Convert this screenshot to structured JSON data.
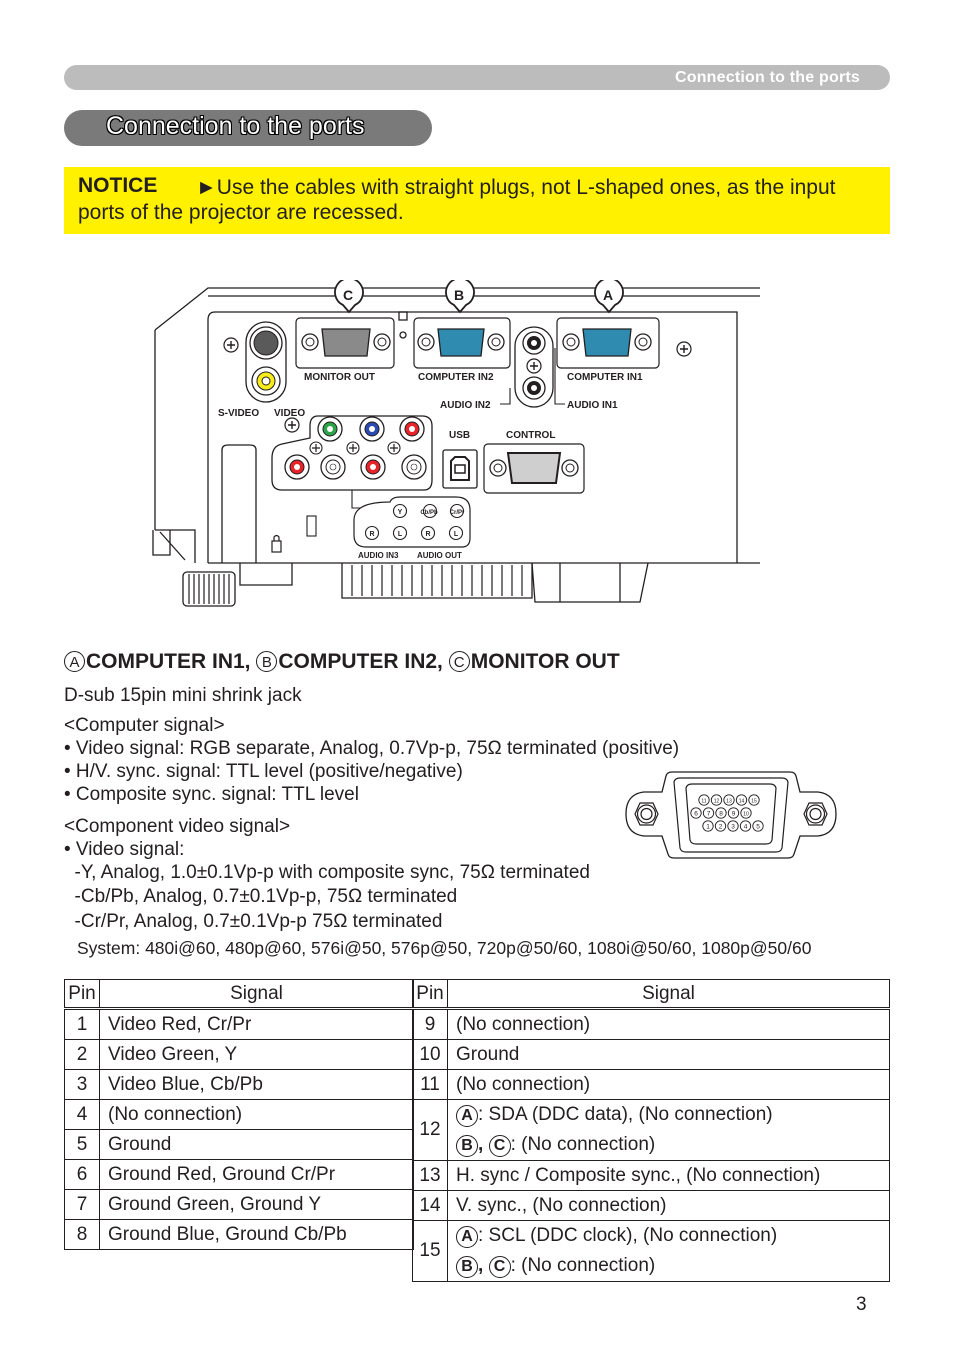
{
  "header": {
    "running_title": "Connection to the ports"
  },
  "page_title": "Connection to the ports",
  "notice": {
    "label": "NOTICE",
    "text": "►Use the cables with straight plugs, not L-shaped ones, as  the input ports of the projector are recessed."
  },
  "diagram": {
    "callouts": [
      "A",
      "B",
      "C"
    ],
    "port_labels": {
      "monitor_out": "MONITOR OUT",
      "computer_in2": "COMPUTER IN2",
      "computer_in1": "COMPUTER IN1",
      "audio_in2": "AUDIO IN2",
      "audio_in1": "AUDIO IN1",
      "s_video": "S-VIDEO",
      "video": "VIDEO",
      "usb": "USB",
      "control": "CONTROL",
      "y": "Y",
      "cb_pb": "Cb/Pb",
      "cr_pr": "Cr/Pr",
      "r1": "R",
      "l1": "L",
      "r2": "R",
      "l2": "L",
      "audio_in3": "AUDIO IN3",
      "audio_out": "AUDIO OUT"
    },
    "colors": {
      "vga_blue": "#2f8bb0",
      "vga_gray": "#8a8a8a",
      "green": "#2da44a",
      "blue": "#2b4bb0",
      "red": "#e8232a",
      "yellow": "#f7ec1a"
    }
  },
  "section": {
    "heading_parts": [
      {
        "badge": "A",
        "text": "COMPUTER IN1, "
      },
      {
        "badge": "B",
        "text": "COMPUTER IN2, "
      },
      {
        "badge": "C",
        "text": "MONITOR OUT"
      }
    ],
    "connector_type": "D-sub 15pin mini shrink jack",
    "computer_signal_title": "<Computer signal>",
    "computer_signal": [
      "• Video signal: RGB separate, Analog, 0.7Vp-p, 75Ω terminated (positive)",
      "• H/V. sync. signal: TTL level (positive/negative)",
      "• Composite sync. signal: TTL level"
    ],
    "component_signal_title": "<Component video signal>",
    "component_signal": [
      "• Video signal:",
      "  -Y, Analog, 1.0±0.1Vp-p with composite sync, 75Ω terminated",
      "  -Cb/Pb, Analog, 0.7±0.1Vp-p, 75Ω terminated",
      "  -Cr/Pr, Analog, 0.7±0.1Vp-p 75Ω terminated"
    ],
    "system": "System: 480i@60, 480p@60, 576i@50, 576p@50, 720p@50/60, 1080i@50/60, 1080p@50/60"
  },
  "connector_pins": {
    "row1": [
      "11",
      "12",
      "13",
      "14",
      "15"
    ],
    "row2": [
      "6",
      "7",
      "8",
      "9",
      "10"
    ],
    "row3": [
      "1",
      "2",
      "3",
      "4",
      "5"
    ]
  },
  "pin_table": {
    "headers": {
      "pin": "Pin",
      "signal": "Signal"
    },
    "left": [
      {
        "pin": "1",
        "signal": "Video Red, Cr/Pr"
      },
      {
        "pin": "2",
        "signal": "Video Green, Y"
      },
      {
        "pin": "3",
        "signal": "Video Blue, Cb/Pb"
      },
      {
        "pin": "4",
        "signal": "(No connection)"
      },
      {
        "pin": "5",
        "signal": "Ground"
      },
      {
        "pin": "6",
        "signal": "Ground Red, Ground Cr/Pr"
      },
      {
        "pin": "7",
        "signal": "Ground Green, Ground Y"
      },
      {
        "pin": "8",
        "signal": "Ground Blue, Ground Cb/Pb"
      }
    ],
    "right": [
      {
        "pin": "9",
        "signal": "(No connection)"
      },
      {
        "pin": "10",
        "signal": "Ground"
      },
      {
        "pin": "11",
        "signal": "(No connection)"
      },
      {
        "pin": "12",
        "line1_badge": "A",
        "line1": ": SDA (DDC data), (No connection)",
        "line2_badges": [
          "B",
          "C"
        ],
        "line2": ": (No connection)"
      },
      {
        "pin": "13",
        "signal": "H. sync / Composite sync., (No connection)"
      },
      {
        "pin": "14",
        "signal": "V. sync., (No connection)"
      },
      {
        "pin": "15",
        "line1_badge": "A",
        "line1": ": SCL (DDC clock), (No connection)",
        "line2_badges": [
          "B",
          "C"
        ],
        "line2": ": (No connection)"
      }
    ]
  },
  "page_number": "3"
}
